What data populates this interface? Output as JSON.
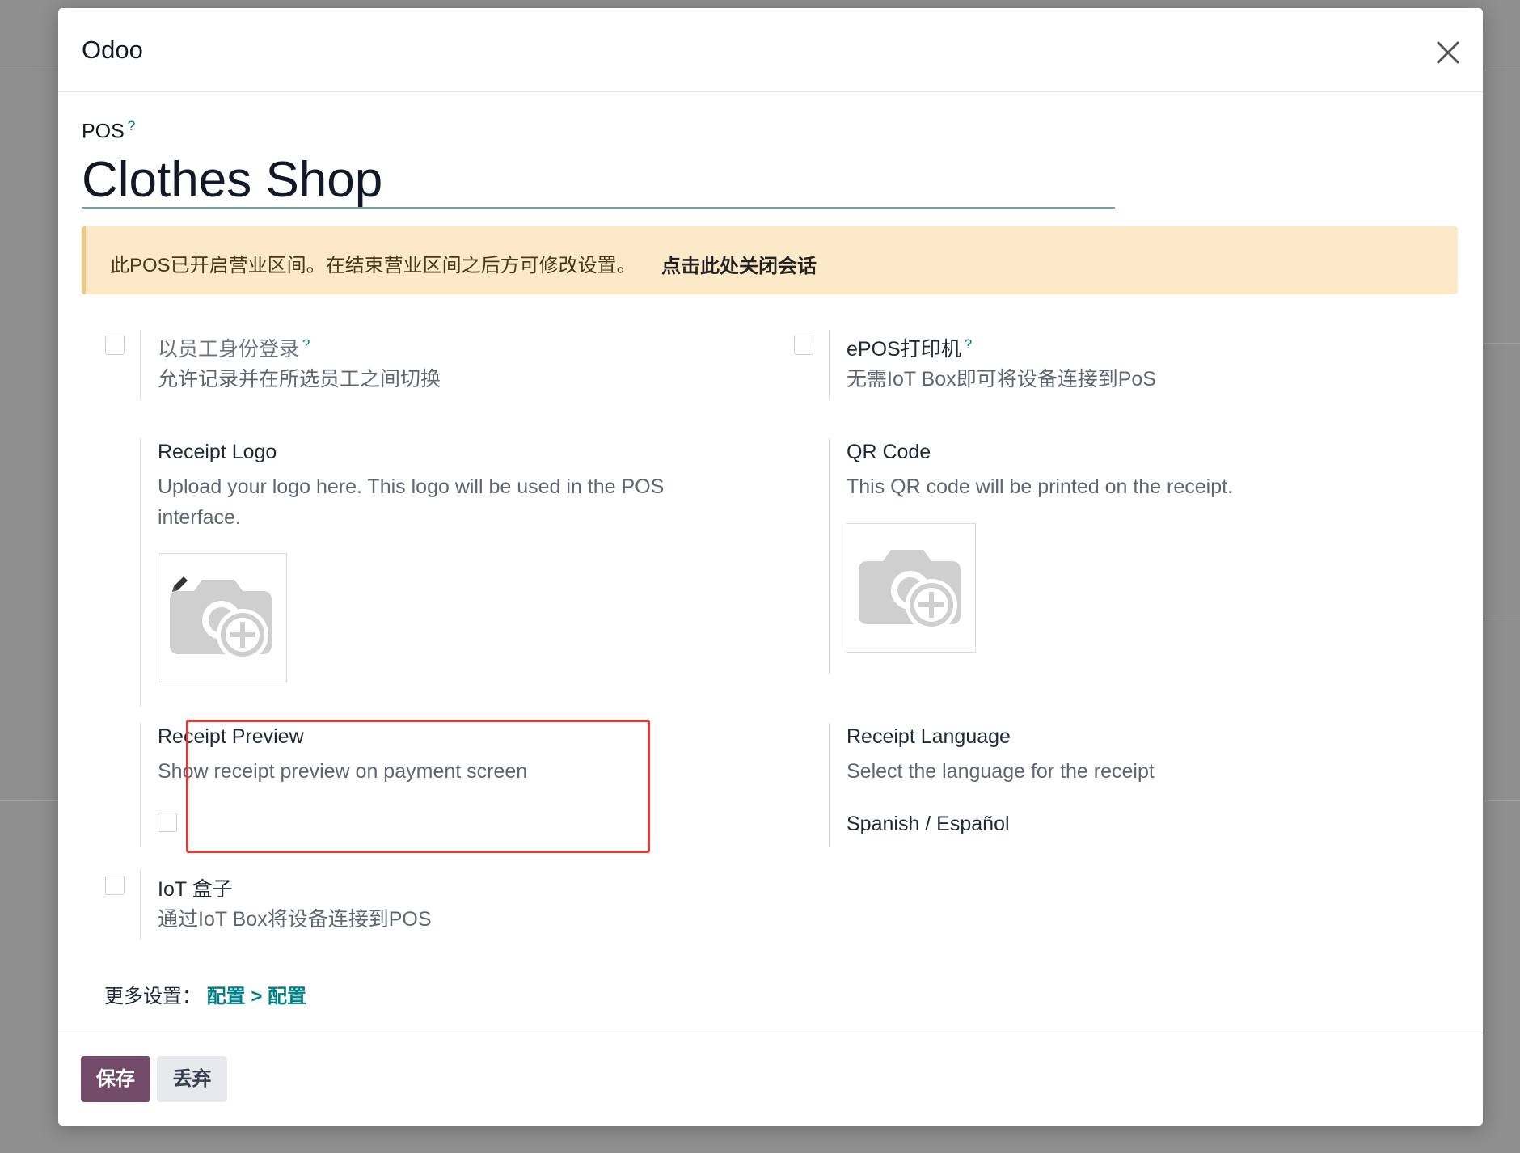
{
  "modal": {
    "title": "Odoo",
    "pos_label": "POS",
    "help_mark": "?",
    "name": "Clothes Shop"
  },
  "alert": {
    "text": "此POS已开启营业区间。在结束营业区间之后方可修改设置。",
    "link": "点击此处关闭会话"
  },
  "settings": {
    "employee_login": {
      "title": "以员工身份登录",
      "desc": "允许记录并在所选员工之间切换",
      "checked": false
    },
    "epos_printer": {
      "title": "ePOS打印机",
      "desc": "无需IoT Box即可将设备连接到PoS",
      "checked": false
    },
    "receipt_logo": {
      "title": "Receipt Logo",
      "desc": "Upload your logo here. This logo will be used in the POS interface."
    },
    "qr_code": {
      "title": "QR Code",
      "desc": "This QR code will be printed on the receipt."
    },
    "receipt_preview": {
      "title": "Receipt Preview",
      "desc": "Show receipt preview on payment screen",
      "checked": false
    },
    "receipt_language": {
      "title": "Receipt Language",
      "desc": "Select the language for the receipt",
      "value": "Spanish / Español"
    },
    "iot_box": {
      "title": "IoT 盒子",
      "desc": "通过IoT Box将设备连接到POS",
      "checked": false
    }
  },
  "more_settings": {
    "label": "更多设置：",
    "link": "配置 > 配置"
  },
  "footer": {
    "save_label": "保存",
    "discard_label": "丢弃"
  },
  "colors": {
    "primary": "#714b67",
    "link": "#017e84",
    "alert_bg": "#fbe9c8",
    "highlight": "#e53935"
  }
}
